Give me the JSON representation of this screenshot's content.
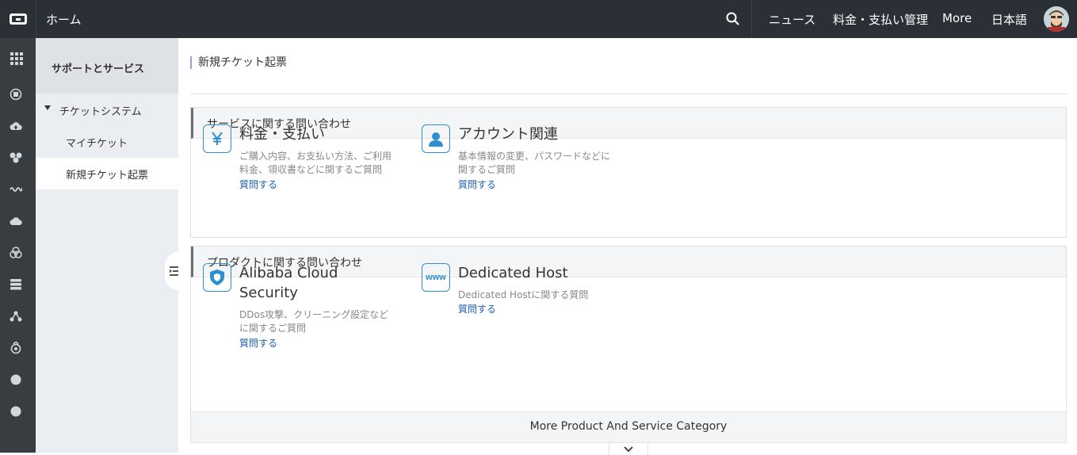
{
  "topbar": {
    "home_label": "ホーム",
    "nav": [
      "ニュース",
      "料金・支払い管理",
      "More",
      "日本語"
    ],
    "icons": {
      "logo": "alibaba-cloud-logo-icon",
      "search": "search-icon",
      "avatar": "user-avatar"
    }
  },
  "rail": {
    "icons": [
      "grid-icon",
      "ecs-icon",
      "cloud-upload-icon",
      "cluster-icon",
      "wave-icon",
      "cloud-db-icon",
      "network-icon",
      "storage-icon",
      "share-icon",
      "gear-cloud-icon",
      "dot-icon",
      "dot-icon"
    ]
  },
  "sidebar": {
    "header": "サポートとサービス",
    "group": "チケットシステム",
    "items": [
      "マイチケット",
      "新規チケット起票"
    ]
  },
  "main": {
    "title": "新規チケット起票",
    "service_panel": {
      "heading": "サービスに関する問い合わせ",
      "cards": [
        {
          "icon": "yen-icon",
          "title": "料金・支払い",
          "desc": [
            "ご購入内容、お支払い方法、ご利用",
            "料金、領収書などに関するご質問"
          ],
          "link": "質問する"
        },
        {
          "icon": "account-icon",
          "title": "アカウント関連",
          "desc": [
            "基本情報の変更、パスワードなどに",
            "関するご質問"
          ],
          "link": "質問する"
        }
      ]
    },
    "product_panel": {
      "heading": "プロダクトに関する問い合わせ",
      "cards": [
        {
          "icon": "shield-icon",
          "title_lines": [
            "Alibaba Cloud",
            "Security"
          ],
          "desc": [
            "DDos攻撃、クリーニング設定など",
            "に関するご質問"
          ],
          "link": "質問する"
        },
        {
          "icon": "www-icon",
          "title_lines": [
            "Dedicated Host"
          ],
          "desc": [
            "Dedicated Hostに関する質問"
          ],
          "link": "質問する"
        }
      ]
    },
    "more_label": "More Product And Service Category"
  }
}
